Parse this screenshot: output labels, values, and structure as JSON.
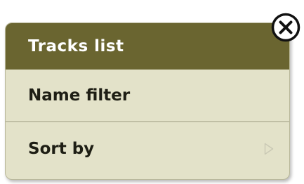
{
  "popup": {
    "title": "Tracks list",
    "items": [
      {
        "label": "Name filter",
        "has_submenu": false
      },
      {
        "label": "Sort by",
        "has_submenu": true
      }
    ],
    "close_icon": "close-icon",
    "submenu_icon": "chevron-right-outline-icon"
  },
  "colors": {
    "header_bg": "#6a6530",
    "menu_bg": "#e3e2c9",
    "text": "#1e1e14",
    "divider": "#9d9c82"
  }
}
